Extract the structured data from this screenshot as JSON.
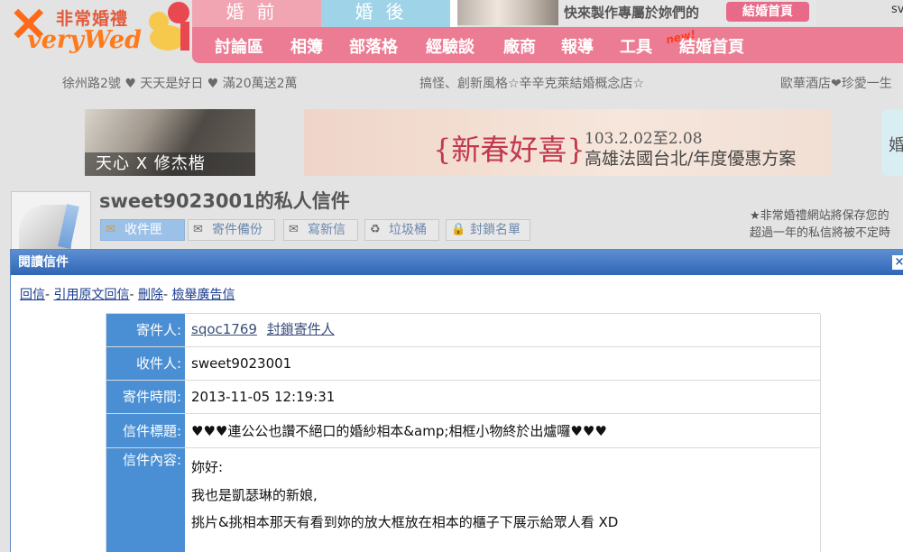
{
  "header": {
    "logo_cn": "非常婚禮",
    "logo_en": "veryWed",
    "tab_before": "婚前",
    "tab_after": "婚後",
    "promo_text": "快來製作專屬於妳們的",
    "promo_button": "結婚首頁",
    "user_corner": "sv",
    "nav": [
      "討論區",
      "相簿",
      "部落格",
      "經驗談",
      "廠商",
      "報導",
      "工具",
      "結婚首頁"
    ],
    "new_badge": "new!"
  },
  "marquee": [
    "徐州路2號 ♥ 天天是好日 ♥ 滿20萬送2萬",
    "搞怪、創新風格☆辛辛克萊結婚概念店☆",
    "歐華酒店❤珍愛一生"
  ],
  "banners": {
    "b1_caption": "天心 X 修杰楷",
    "b2_main": "{新春好喜}",
    "b2_date": "103.2.02至2.08",
    "b2_plan": "高雄法國台北/年度優惠方案",
    "b3_text": "婚"
  },
  "profile": {
    "title": "sweet9023001的私人信件",
    "notice_line1": "★非常婚禮網站將保存您的",
    "notice_line2": "超過一年的私信將被不定時"
  },
  "mail_tabs": [
    {
      "label": "收件匣",
      "icon": "inbox-icon",
      "active": true
    },
    {
      "label": "寄件備份",
      "icon": "outbox-icon",
      "active": false
    },
    {
      "label": "寫新信",
      "icon": "compose-icon",
      "active": false
    },
    {
      "label": "垃圾桶",
      "icon": "trash-icon",
      "active": false
    },
    {
      "label": "封鎖名單",
      "icon": "lock-icon",
      "active": false
    }
  ],
  "modal": {
    "title": "閱讀信件",
    "close": "×",
    "actions": [
      "回信",
      "引用原文回信",
      "刪除",
      "檢舉廣告信"
    ]
  },
  "mail": {
    "sender_label": "寄件人:",
    "sender": "sqoc1769",
    "block_sender": "封鎖寄件人",
    "recipient_label": "收件人:",
    "recipient": "sweet9023001",
    "time_label": "寄件時間:",
    "time": "2013-11-05 12:19:31",
    "subject_label": "信件標題:",
    "subject": "♥♥♥連公公也讚不絕口的婚紗相本&amp;相框小物終於出爐囉♥♥♥",
    "content_label": "信件內容:",
    "content_lines": [
      "妳好:",
      "我也是凱瑟琳的新娘,",
      "挑片&挑相本那天有看到妳的放大框放在相本的櫃子下展示給眾人看 XD"
    ]
  }
}
